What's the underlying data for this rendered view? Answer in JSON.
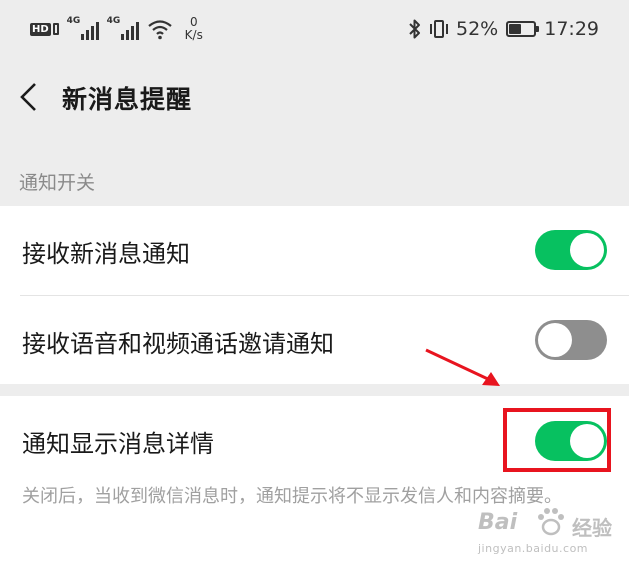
{
  "status_bar": {
    "hd_label": "HD",
    "signal1_label": "4G",
    "signal2_label": "4G",
    "speed_value": "0",
    "speed_unit": "K/s",
    "battery_text": "52%",
    "battery_level": 0.52,
    "time": "17:29",
    "icons": [
      "hd-icon",
      "signal-icon",
      "wifi-icon",
      "bluetooth-icon",
      "vibrate-icon",
      "battery-icon"
    ]
  },
  "title_bar": {
    "back_icon": "chevron-left-icon",
    "title": "新消息提醒"
  },
  "section": {
    "header": "通知开关"
  },
  "settings": [
    {
      "label": "接收新消息通知",
      "enabled": true
    },
    {
      "label": "接收语音和视频通话邀请通知",
      "enabled": false
    },
    {
      "label": "通知显示消息详情",
      "enabled": true,
      "description": "关闭后，当收到微信消息时，通知提示将不显示发信人和内容摘要。"
    }
  ],
  "colors": {
    "accent": "#07c160",
    "toggle_off": "#8e8e8e",
    "annotation": "#e8141f",
    "background": "#ededed"
  },
  "watermark": {
    "brand": "Bai",
    "brand2": "经验",
    "url": "jingyan.baidu.com"
  }
}
